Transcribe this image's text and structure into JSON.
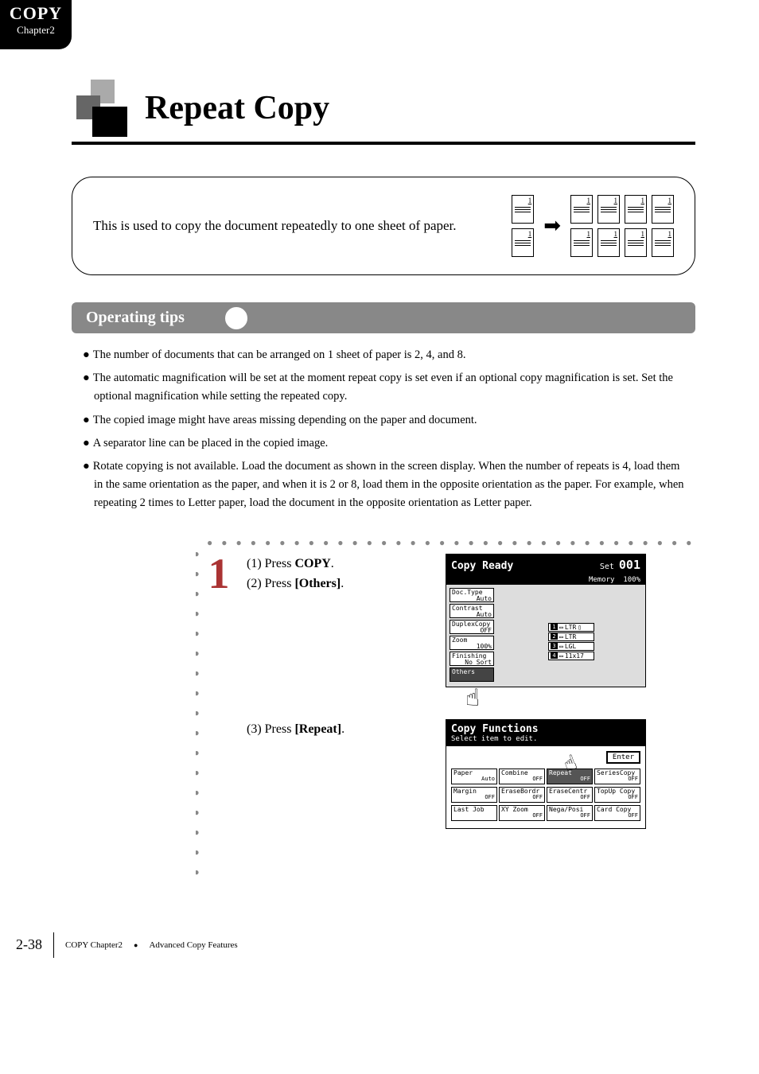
{
  "corner": {
    "big": "COPY",
    "small": "Chapter2"
  },
  "title": "Repeat Copy",
  "intro": "This is used to copy the document repeatedly to one sheet of paper.",
  "section_heading": "Operating tips",
  "tips": [
    "The number of documents that can be arranged on 1 sheet of paper is 2, 4, and 8.",
    "The automatic magnification will be set at the moment repeat copy is set even if an optional copy magnification is set. Set the optional magnification while setting the repeated copy.",
    "The copied image might have areas missing depending on the paper and document.",
    "A separator line can be placed in the copied image.",
    "Rotate copying is not available. Load the document as shown in the screen display. When the number of repeats is 4, load them in the same orientation as the paper, and when it is 2 or 8, load them in the opposite orientation as the paper. For example, when repeating 2 times to Letter paper, load the document in the opposite orientation as Letter     paper."
  ],
  "big_step_number": "1",
  "step1": {
    "line1_pre": "(1) Press ",
    "line1_strong": "COPY",
    "line1_post": ".",
    "line2_pre": "(2) Press ",
    "line2_strong": "[Others]",
    "line2_post": "."
  },
  "step2": {
    "line_pre": "(3) Press ",
    "line_strong": "[Repeat]",
    "line_post": "."
  },
  "screen1": {
    "title": "Copy Ready",
    "set_label": "Set",
    "set_value": "001",
    "memory_label": "Memory",
    "memory_value": "100%",
    "side": [
      {
        "label": "Doc.Type",
        "value": "Auto"
      },
      {
        "label": "Contrast",
        "value": "Auto"
      },
      {
        "label": "DuplexCopy",
        "value": "OFF"
      },
      {
        "label": "Zoom",
        "value": "100%"
      },
      {
        "label": "Finishing",
        "value": "No Sort"
      },
      {
        "label": "Others",
        "value": ""
      }
    ],
    "trays": [
      {
        "n": "1",
        "label": "LTR"
      },
      {
        "n": "2",
        "label": "LTR"
      },
      {
        "n": "3",
        "label": "LGL"
      },
      {
        "n": "4",
        "label": "11x17"
      }
    ]
  },
  "screen2": {
    "title": "Copy Functions",
    "subtitle": "Select item to edit.",
    "enter": "Enter",
    "rows": [
      [
        {
          "label": "Paper",
          "value": "Auto"
        },
        {
          "label": "Combine",
          "value": "OFF"
        },
        {
          "label": "Repeat",
          "value": "OFF",
          "dark": true
        },
        {
          "label": "SeriesCopy",
          "value": "OFF"
        }
      ],
      [
        {
          "label": "Margin",
          "value": "OFF"
        },
        {
          "label": "EraseBordr",
          "value": "OFF"
        },
        {
          "label": "EraseCentr",
          "value": "OFF"
        },
        {
          "label": "TopUp Copy",
          "value": "OFF"
        }
      ],
      [
        {
          "label": "Last Job",
          "value": ""
        },
        {
          "label": "XY Zoom",
          "value": "OFF"
        },
        {
          "label": "Nega/Posi",
          "value": "OFF"
        },
        {
          "label": "Card Copy",
          "value": "OFF"
        }
      ]
    ]
  },
  "footer": {
    "page": "2-38",
    "chapter": "COPY Chapter2",
    "section": "Advanced Copy Features"
  }
}
